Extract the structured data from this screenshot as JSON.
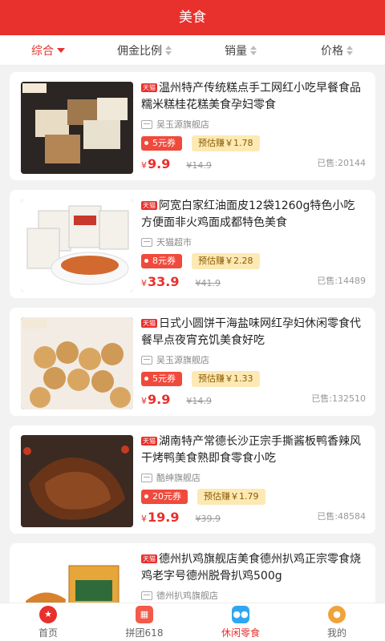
{
  "header": {
    "title": "美食"
  },
  "sort": [
    {
      "label": "综合"
    },
    {
      "label": "佣金比例"
    },
    {
      "label": "销量"
    },
    {
      "label": "价格"
    }
  ],
  "products": [
    {
      "badge": "天猫",
      "title": "温州特产传统糕点手工网红小吃早餐食品糯米糕桂花糕美食孕妇零食",
      "shop": "吴玉源旗舰店",
      "coupon": "5元券",
      "earn": "预估赚￥1.78",
      "currency": "¥",
      "price": "9.9",
      "orig": "¥14.9",
      "sold": "已售:20144"
    },
    {
      "badge": "天猫",
      "title": "阿宽白家红油面皮12袋1260g特色小吃方便面非火鸡面成都特色美食",
      "shop": "天猫超市",
      "coupon": "8元券",
      "earn": "预估赚￥2.28",
      "currency": "¥",
      "price": "33.9",
      "orig": "¥41.9",
      "sold": "已售:14489"
    },
    {
      "badge": "天猫",
      "title": "日式小圆饼干海盐味网红孕妇休闲零食代餐早点夜宵充饥美食好吃",
      "shop": "吴玉源旗舰店",
      "coupon": "5元券",
      "earn": "预估赚￥1.33",
      "currency": "¥",
      "price": "9.9",
      "orig": "¥14.9",
      "sold": "已售:132510"
    },
    {
      "badge": "天猫",
      "title": "湖南特产常德长沙正宗手撕酱板鸭香辣风干烤鸭美食熟即食零食小吃",
      "shop": "酷绅旗舰店",
      "coupon": "20元券",
      "earn": "预估赚￥1.79",
      "currency": "¥",
      "price": "19.9",
      "orig": "¥39.9",
      "sold": "已售:48584"
    },
    {
      "badge": "天猫",
      "title": "德州扒鸡旗舰店美食德州扒鸡正宗零食烧鸡老字号德州脱骨扒鸡500g",
      "shop": "德州扒鸡旗舰店",
      "coupon": "",
      "earn": "",
      "currency": "",
      "price": "",
      "orig": "",
      "sold": ""
    }
  ],
  "tabs": [
    {
      "label": "首页",
      "icon": "home-icon",
      "color": "#e8302c"
    },
    {
      "label": "拼团618",
      "icon": "calendar-icon",
      "color": "#f25a4a"
    },
    {
      "label": "休闲零食",
      "icon": "snack-icon",
      "color": "#2fa7f0"
    },
    {
      "label": "我的",
      "icon": "profile-icon",
      "color": "#f0a33a"
    }
  ],
  "colors": {
    "accent": "#e8302c",
    "earn_bg": "#fde9b4"
  }
}
